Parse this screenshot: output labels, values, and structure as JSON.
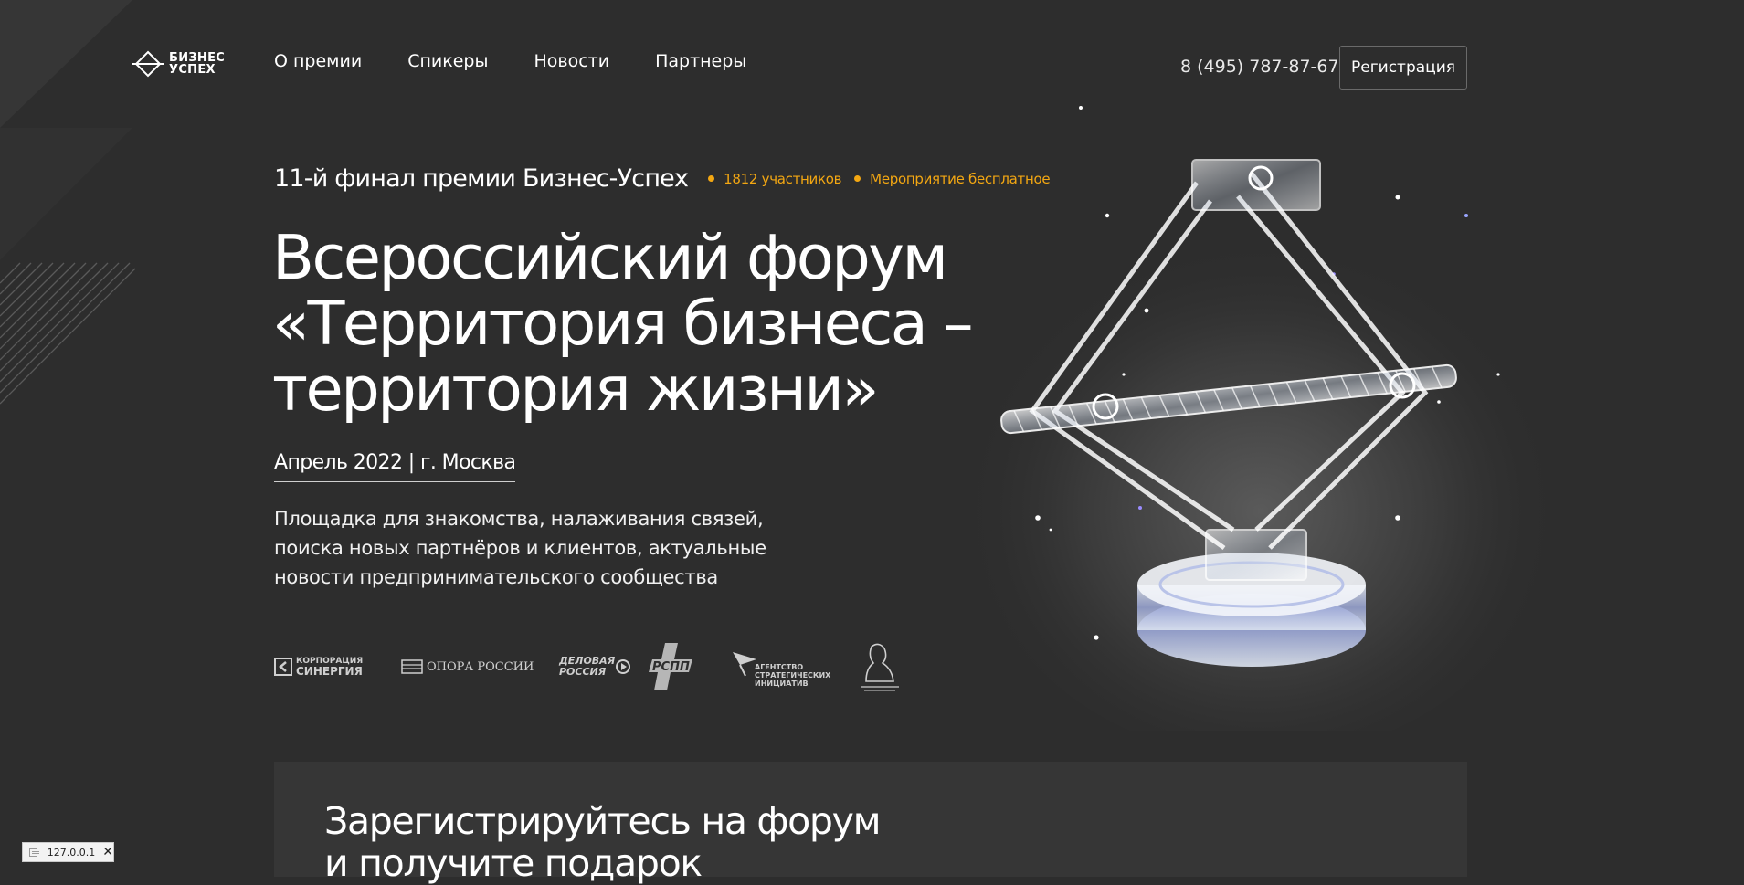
{
  "header": {
    "logo_line1": "БИЗНЕС",
    "logo_line2": "УСПЕХ",
    "nav": [
      "О премии",
      "Спикеры",
      "Новости",
      "Партнеры"
    ],
    "phone": "8 (495) 787-87-67",
    "register_label": "Регистрация"
  },
  "hero": {
    "kicker": "11-й финал премии Бизнес-Успех",
    "badges": [
      "1812 участников",
      "Мероприятие бесплатное"
    ],
    "headline": [
      "Всероссийский форум",
      "«Территория бизнеса –",
      "территория жизни»"
    ],
    "date": "Апрель 2022 | г. Москва",
    "description": [
      "Площадка для знакомства, налаживания связей,",
      "поиска новых партнёров и клиентов, актуальные",
      "новости предпринимательского сообщества"
    ]
  },
  "partners": {
    "sinergiya_line1": "КОРПОРАЦИЯ",
    "sinergiya_line2": "СИНЕРГИЯ",
    "opora": "ОПОРА РОССИИ",
    "delovaya_line1": "ДЕЛОВАЯ",
    "delovaya_line2": "РОССИЯ",
    "rspp": "РСПП",
    "asi_line1": "АГЕНТСТВО",
    "asi_line2": "СТРАТЕГИЧЕСКИХ",
    "asi_line3": "ИНИЦИАТИВ"
  },
  "registration": {
    "title": [
      "Зарегистрируйтесь на форум",
      "и получите подарок"
    ]
  },
  "status_chip": {
    "text": "127.0.0.1"
  },
  "colors": {
    "background": "#2d2d2d",
    "accent": "#f3a712",
    "panel": "#363636"
  }
}
